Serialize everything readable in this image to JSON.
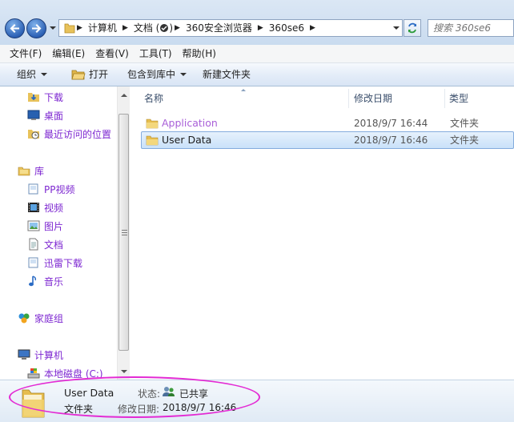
{
  "address": {
    "crumbs": [
      "计算机",
      "文档 (",
      ")",
      "360安全浏览器",
      "360se6"
    ],
    "search_placeholder": "搜索 360se6"
  },
  "menubar": [
    "文件(F)",
    "编辑(E)",
    "查看(V)",
    "工具(T)",
    "帮助(H)"
  ],
  "toolbar": {
    "organize": "组织",
    "open": "打开",
    "include_library": "包含到库中",
    "new_folder": "新建文件夹"
  },
  "nav": {
    "downloads": "下载",
    "desktop": "桌面",
    "recent": "最近访问的位置",
    "libraries": "库",
    "pp_video": "PP视频",
    "videos": "视频",
    "pictures": "图片",
    "documents": "文档",
    "thunder": "迅雷下载",
    "music": "音乐",
    "homegroup": "家庭组",
    "computer": "计算机",
    "local_disk": "本地磁盘 (C:)"
  },
  "columns": {
    "name": "名称",
    "modified": "修改日期",
    "type": "类型"
  },
  "files": [
    {
      "name": "Application",
      "modified": "2018/9/7 16:44",
      "type": "文件夹"
    },
    {
      "name": "User Data",
      "modified": "2018/9/7 16:46",
      "type": "文件夹"
    }
  ],
  "details": {
    "name": "User Data",
    "type": "文件夹",
    "status_label": "状态:",
    "status_value": "已共享",
    "modified_label": "修改日期:",
    "modified_value": "2018/9/7 16:46"
  },
  "colors": {
    "highlight_ellipse": "#e32bd4",
    "visited_link": "#7d27d1",
    "selection": "#c9e1f9"
  }
}
